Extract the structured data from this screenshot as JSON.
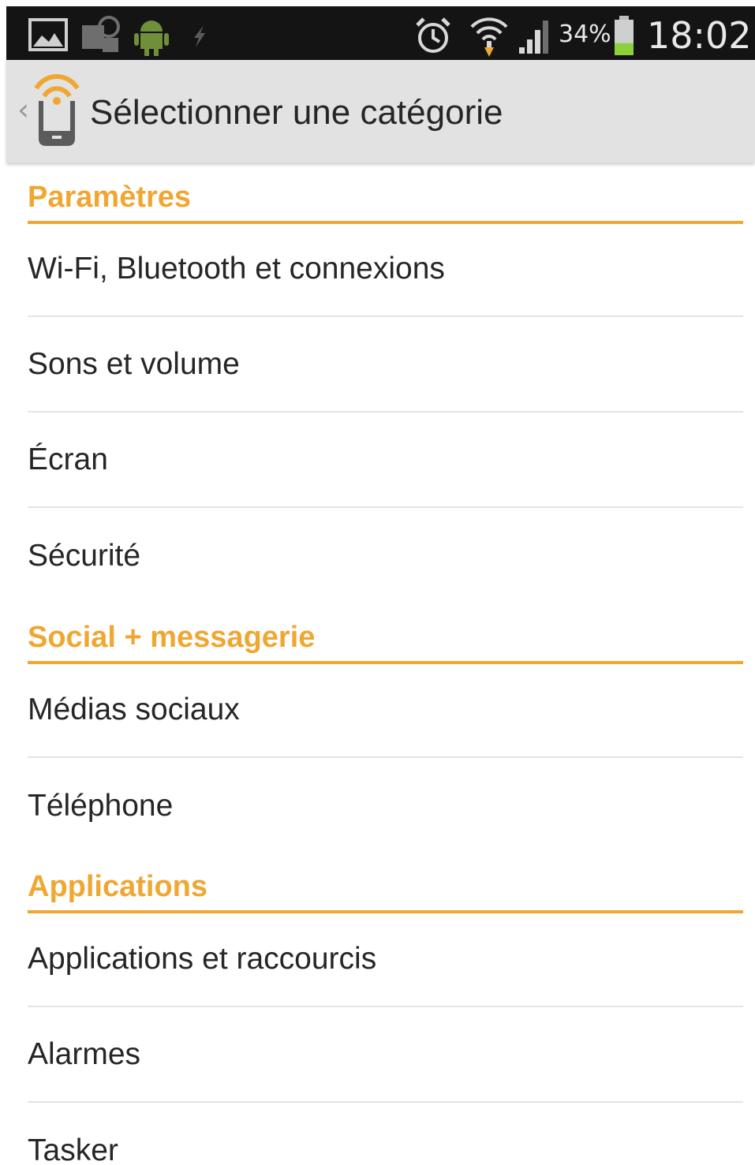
{
  "status_bar": {
    "icons": [
      "gallery-icon",
      "sync-icon",
      "android-icon",
      "usb-icon",
      "alarm-icon",
      "wifi-icon",
      "signal-icon",
      "battery-icon"
    ],
    "battery_percent": "34%",
    "battery_level": 0.34,
    "time": "18:02"
  },
  "action_bar": {
    "title": "Sélectionner une catégorie",
    "icon": "phone-wifi-app-icon"
  },
  "sections": [
    {
      "header": "Paramètres",
      "items": [
        {
          "label": "Wi-Fi, Bluetooth et connexions"
        },
        {
          "label": "Sons et volume"
        },
        {
          "label": "Écran"
        },
        {
          "label": "Sécurité"
        }
      ]
    },
    {
      "header": "Social + messagerie",
      "items": [
        {
          "label": "Médias sociaux"
        },
        {
          "label": "Téléphone"
        }
      ]
    },
    {
      "header": "Applications",
      "items": [
        {
          "label": "Applications et raccourcis"
        },
        {
          "label": "Alarmes"
        },
        {
          "label": "Tasker"
        }
      ]
    }
  ],
  "colors": {
    "accent": "#f0a732",
    "status_bar_bg": "#141414",
    "action_bar_bg": "#e2e2e2",
    "text": "#262626",
    "divider": "#e4e4e4",
    "battery_fill": "#8cd13a"
  }
}
